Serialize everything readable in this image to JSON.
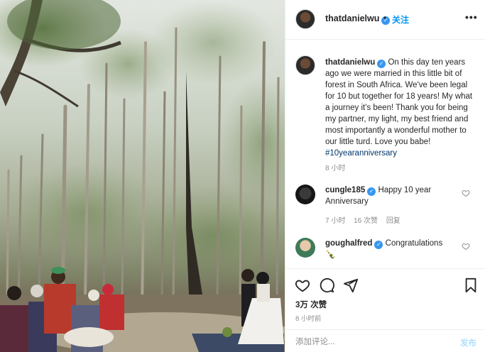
{
  "post": {
    "username": "thatdanielwu",
    "verified_mark": "✓",
    "separator": "•",
    "follow_label": "关注",
    "more_icon": "more-horizontal-icon",
    "more_label": "•••",
    "caption_username": "thatdanielwu",
    "caption_text": "On this day ten years ago we were married in this little bit of forest in South Africa. We've been legal for 10 but together for 18 years! My what a journey it's been! Thank you for being my partner, my light, my best friend and most importantly a wonderful mother to our little turd. Love you babe! ",
    "hashtag": "#10yearanniversary",
    "caption_time": "8 小时"
  },
  "comments": [
    {
      "username": "cungle185",
      "text": "Happy 10 year Anniversary",
      "time": "7 小时",
      "likes": "16 次赞",
      "reply": "回复"
    },
    {
      "username": "goughalfred",
      "text": "Congratulations",
      "emoji": "🍾"
    }
  ],
  "actions": {
    "like_icon": "heart-icon",
    "comment_icon": "comment-bubble-icon",
    "share_icon": "paper-plane-icon",
    "save_icon": "bookmark-icon",
    "likes_count": "3万 次赞",
    "posted_time": "8 小时前"
  },
  "add_comment": {
    "placeholder": "添加评论...",
    "post_label": "发布"
  },
  "colors": {
    "accent": "#0095f6",
    "verified": "#3897f0",
    "muted": "#8e8e8e",
    "text": "#262626"
  }
}
